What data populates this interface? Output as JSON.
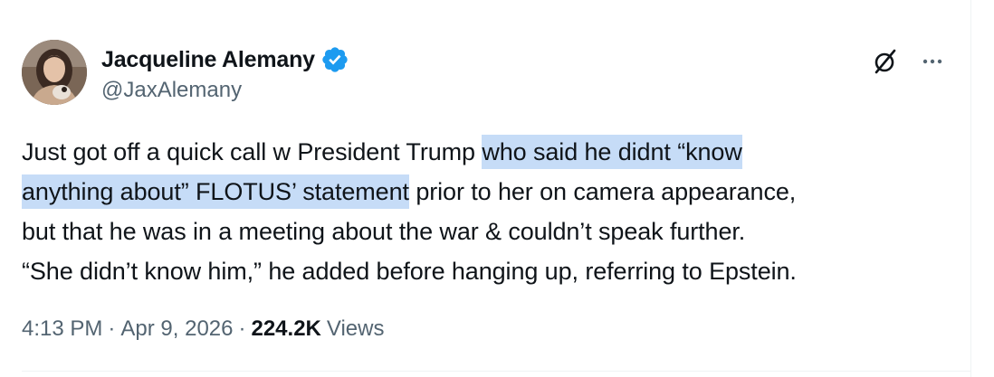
{
  "author": {
    "display_name": "Jacqueline Alemany",
    "handle": "@JaxAlemany",
    "verified": true,
    "avatar_icon": "profile-photo"
  },
  "actions": {
    "grok_icon": "grok-icon",
    "more_icon": "more-horizontal-icon"
  },
  "tweet": {
    "lines": [
      {
        "plain": "Just got off a quick call w President Trump ",
        "highlight": "who said he didnt “know"
      },
      {
        "highlight": "anything about” FLOTUS’ statement",
        "plain": " prior to her on camera appearance,"
      },
      {
        "plain": "but that he was in a meeting about the war & couldn’t speak further."
      },
      {
        "plain": "“She didn’t know him,” he added before hanging up, referring to Epstein."
      }
    ]
  },
  "meta": {
    "time": "4:13 PM",
    "date": "Apr 9, 2026",
    "views_count": "224.2K",
    "views_label": "Views",
    "separator": "·"
  },
  "colors": {
    "text_primary": "#0f1419",
    "text_secondary": "#536471",
    "verified_blue": "#1d9bf0",
    "selection_highlight": "#c6dcf7"
  }
}
